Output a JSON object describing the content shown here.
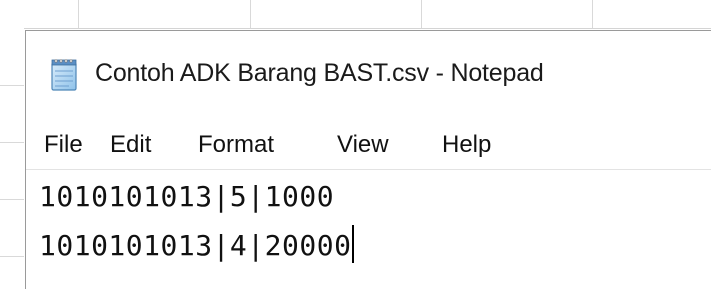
{
  "window": {
    "title": "Contoh ADK Barang BAST.csv - Notepad",
    "icon": "notepad-icon"
  },
  "menu": {
    "items": [
      "File",
      "Edit",
      "Format",
      "View",
      "Help"
    ]
  },
  "editor": {
    "lines": [
      "1010101013|5|1000",
      "1010101013|4|20000"
    ]
  },
  "colors": {
    "text": "#111111",
    "window_background": "#ffffff",
    "grid_line": "#d9d9d9"
  }
}
